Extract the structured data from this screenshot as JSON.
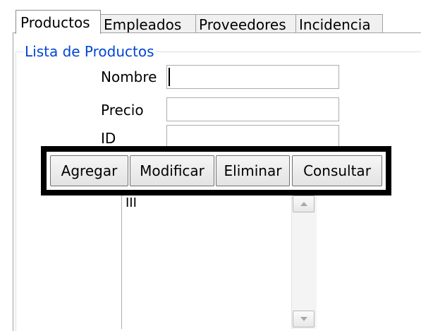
{
  "tabs": [
    {
      "label": "Productos",
      "active": true
    },
    {
      "label": "Empleados",
      "active": false
    },
    {
      "label": "Proveedores",
      "active": false
    },
    {
      "label": "Incidencia",
      "active": false
    }
  ],
  "group": {
    "title": "Lista de Productos"
  },
  "form": {
    "nombre": {
      "label": "Nombre",
      "value": ""
    },
    "precio": {
      "label": "Precio",
      "value": ""
    },
    "id": {
      "label": "ID",
      "value": ""
    }
  },
  "actions": {
    "add": "Agregar",
    "modify": "Modificar",
    "delete": "Eliminar",
    "query": "Consultar"
  },
  "list": {
    "items": [
      "III"
    ]
  },
  "icons": {
    "scroll_up": "arrow-up-icon",
    "scroll_down": "arrow-down-icon"
  },
  "colors": {
    "group_title": "#0046d5",
    "frame": "#000000"
  }
}
